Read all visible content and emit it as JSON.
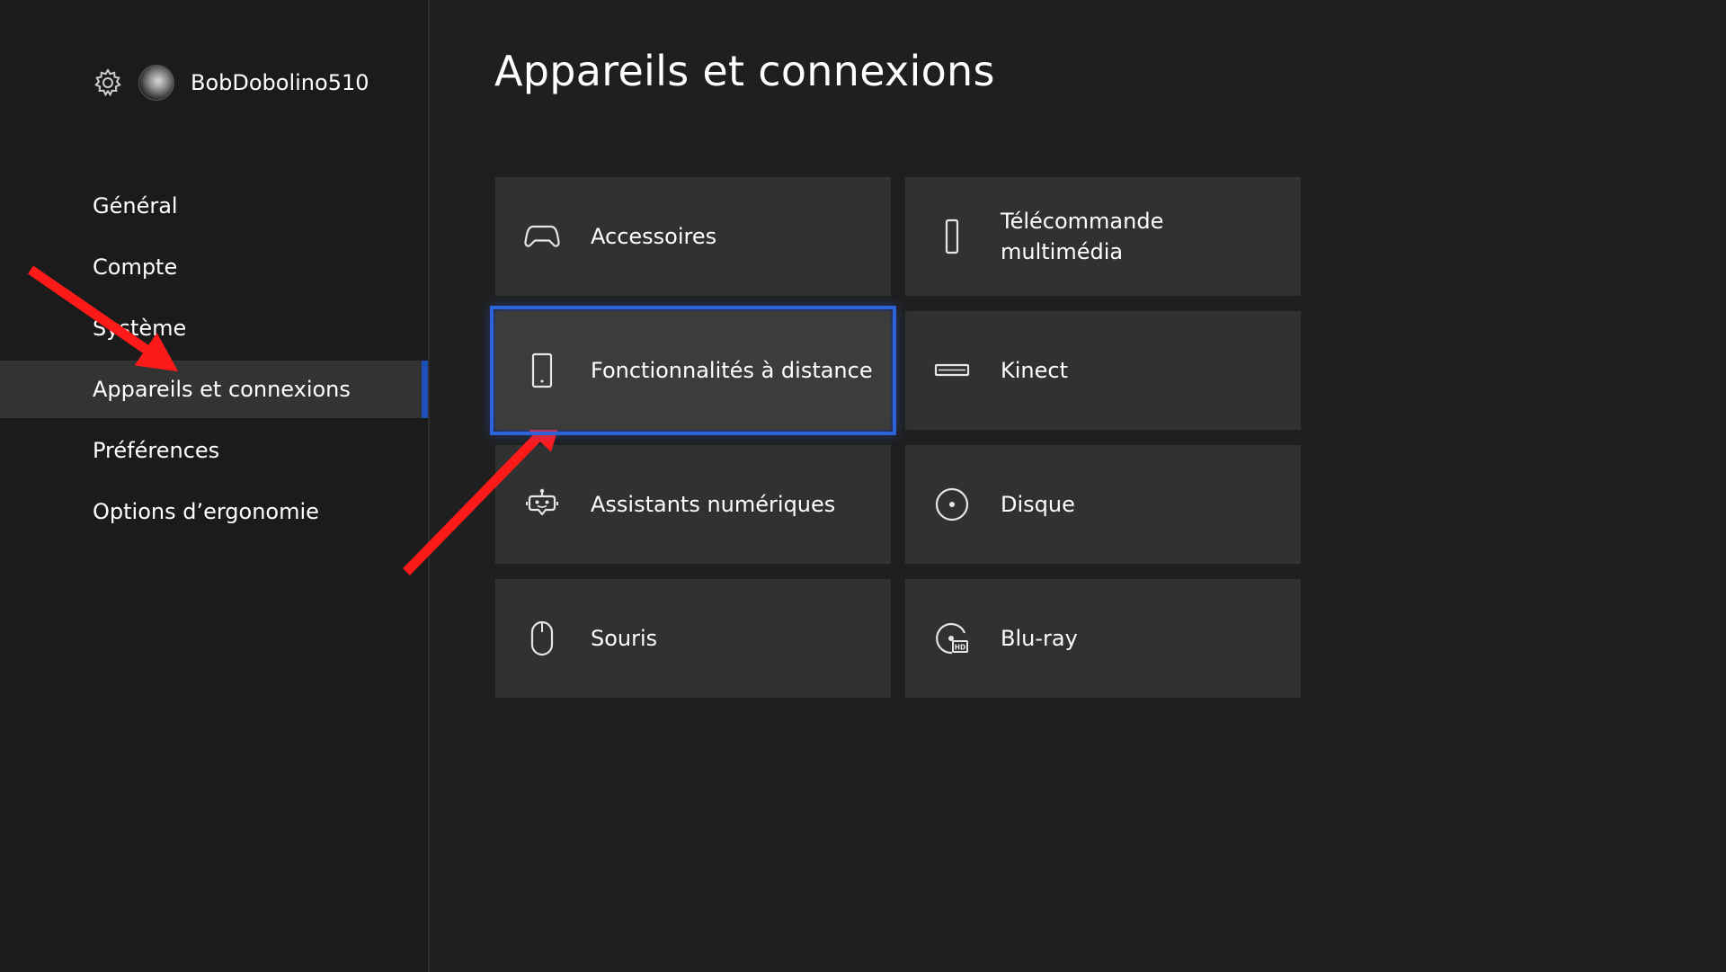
{
  "profile": {
    "username": "BobDobolino510",
    "settings_icon": "gear-icon"
  },
  "sidebar": {
    "items": [
      {
        "label": "Général",
        "selected": false
      },
      {
        "label": "Compte",
        "selected": false
      },
      {
        "label": "Système",
        "selected": false
      },
      {
        "label": "Appareils et connexions",
        "selected": true
      },
      {
        "label": "Préférences",
        "selected": false
      },
      {
        "label": "Options d’ergonomie",
        "selected": false
      }
    ]
  },
  "main": {
    "title": "Appareils et connexions",
    "tiles": [
      {
        "label": "Accessoires",
        "icon": "controller-icon"
      },
      {
        "label": "Télécommande multimédia",
        "icon": "remote-icon"
      },
      {
        "label": "Fonctionnalités à distance",
        "icon": "phone-icon",
        "focused": true
      },
      {
        "label": "Kinect",
        "icon": "kinect-icon"
      },
      {
        "label": "Assistants numériques",
        "icon": "assistant-icon"
      },
      {
        "label": "Disque",
        "icon": "disc-icon"
      },
      {
        "label": "Souris",
        "icon": "mouse-icon"
      },
      {
        "label": "Blu-ray",
        "icon": "bluray-icon"
      }
    ]
  },
  "colors": {
    "background": "#1f1f1f",
    "sidebar": "#1b1b1b",
    "tile": "#313131",
    "accent": "#2e62d9",
    "annotation_arrow": "#ff1a1a"
  }
}
